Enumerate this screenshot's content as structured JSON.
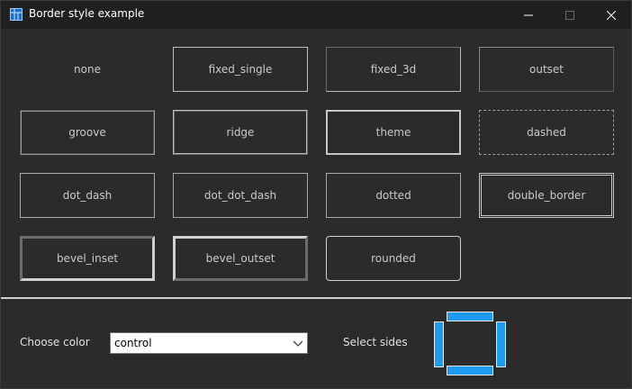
{
  "window": {
    "title": "Border style example",
    "icon": "window-app-icon",
    "controls": [
      "minimize-icon",
      "maximize-icon",
      "close-icon"
    ]
  },
  "buttons": [
    {
      "label": "none"
    },
    {
      "label": "fixed_single"
    },
    {
      "label": "fixed_3d"
    },
    {
      "label": "outset"
    },
    {
      "label": "groove"
    },
    {
      "label": "ridge"
    },
    {
      "label": "theme"
    },
    {
      "label": "dashed"
    },
    {
      "label": "dot_dash"
    },
    {
      "label": "dot_dot_dash"
    },
    {
      "label": "dotted"
    },
    {
      "label": "double_border"
    },
    {
      "label": "bevel_inset"
    },
    {
      "label": "bevel_outset"
    },
    {
      "label": "rounded"
    }
  ],
  "color_picker": {
    "label": "Choose color",
    "value": "control"
  },
  "sides_picker": {
    "label": "Select sides",
    "sides": [
      "top",
      "left",
      "right",
      "bottom"
    ],
    "selected_color": "#1e9bf0"
  }
}
